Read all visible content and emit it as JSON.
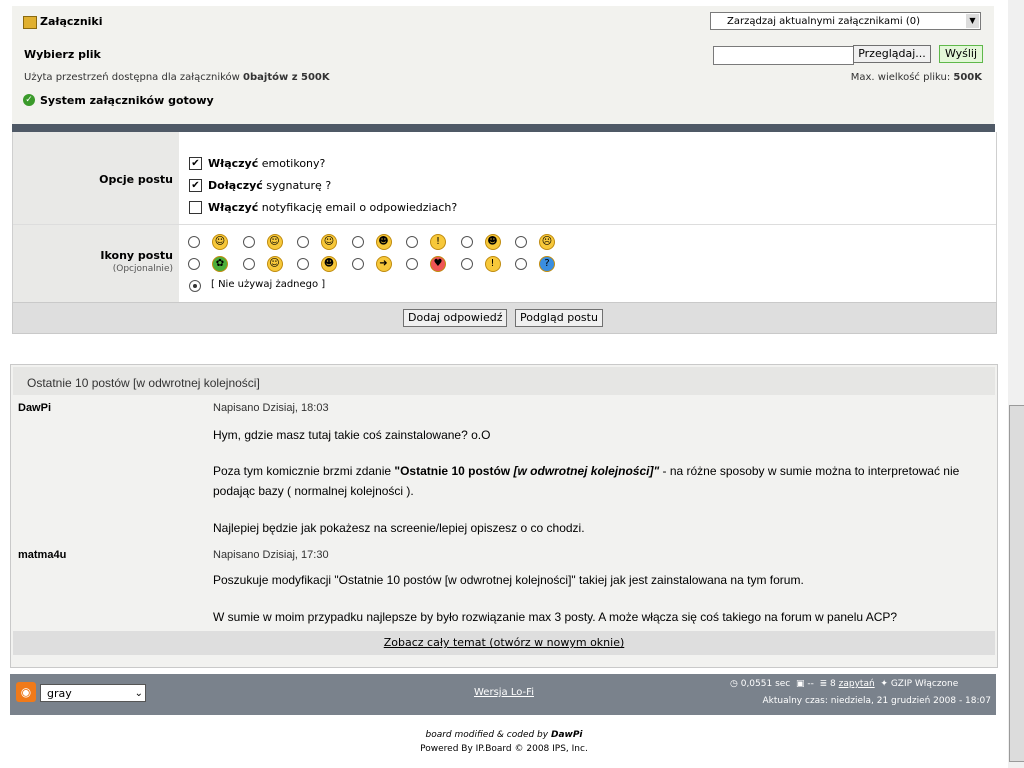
{
  "attach": {
    "title": "Załączniki",
    "manage": "Zarządzaj aktualnymi załącznikami (0)",
    "choose": "Wybierz plik",
    "browse": "Przeglądaj...",
    "send": "Wyślij",
    "used_pre": "Użyta przestrzeń dostępna dla załączników ",
    "used_val": "0bajtów z 500K",
    "max_pre": "Max. wielkość pliku: ",
    "max_val": "500K",
    "ready": "System załączników gotowy"
  },
  "opts": {
    "label": "Opcje postu",
    "o1b": "Włączyć",
    "o1": " emotikony?",
    "o2b": "Dołączyć",
    "o2": " sygnaturę ?",
    "o3b": "Włączyć",
    "o3": " notyfikację email o odpowiedziach?"
  },
  "icons": {
    "label": "Ikony postu",
    "sub": "(Opcjonalnie)",
    "none": "[ Nie używaj żadnego ]"
  },
  "buttons": {
    "add": "Dodaj odpowiedź",
    "preview": "Podgląd postu"
  },
  "recent": {
    "title": "Ostatnie 10 postów [w odwrotnej kolejności]",
    "p1_author": "DawPi",
    "p1_date": "Napisano Dzisiaj, 18:03",
    "p1_l1": "Hym, gdzie masz tutaj takie coś zainstalowane? o.O",
    "p1_l2a": "Poza tym komicznie brzmi zdanie ",
    "p1_l2b": "\"Ostatnie 10 postów ",
    "p1_l2c": "[w odwrotnej kolejności]\"",
    "p1_l2d": " - na różne sposoby w sumie można to interpretować nie",
    "p1_l3": "podając bazy ( normalnej kolejności ).",
    "p1_l4": "Najlepiej będzie jak pokażesz na screenie/lepiej opiszesz o co chodzi.",
    "p2_author": "matma4u",
    "p2_date": "Napisano Dzisiaj, 17:30",
    "p2_l1": "Poszukuje modyfikacji \"Ostatnie 10 postów [w odwrotnej kolejności]\" takiej jak jest zainstalowana na tym forum.",
    "p2_l2": "W sumie w moim przypadku najlepsze by było rozwiązanie max 3 posty. A może włącza się coś takiego na forum w panelu ACP?",
    "view": "Zobacz cały temat (otwórz w nowym oknie)"
  },
  "footer": {
    "skin": "gray",
    "lofi": "Wersja Lo-Fi",
    "sec": "0,0551 sec",
    "dash": "--",
    "q_num": "8",
    "q": "zapytań",
    "gzip": "GZIP Włączone",
    "time": "Aktualny czas: niedziela, 21 grudzień 2008 - 18:07"
  },
  "credits": {
    "l1a": "board modified & coded by ",
    "l1b": "DawPi",
    "l2": "Powered By IP.Board © 2008  IPS, Inc."
  }
}
